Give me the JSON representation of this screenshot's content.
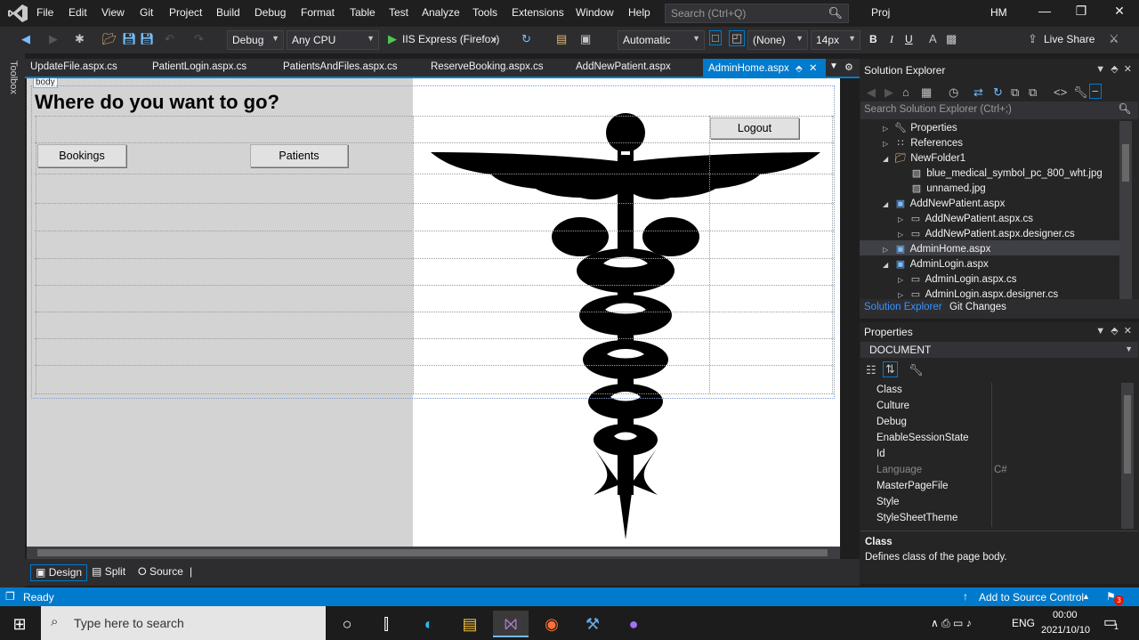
{
  "menubar": {
    "items": [
      "File",
      "Edit",
      "View",
      "Git",
      "Project",
      "Build",
      "Debug",
      "Format",
      "Table",
      "Test",
      "Analyze",
      "Tools",
      "Extensions",
      "Window",
      "Help"
    ],
    "search_placeholder": "Search (Ctrl+Q)",
    "project_name": "Proj",
    "user_initials": "HM"
  },
  "toolbar": {
    "config": "Debug",
    "platform": "Any CPU",
    "run_target": "IIS Express (Firefox)",
    "block_format": "Automatic",
    "style_target": "(None)",
    "font_size": "14px",
    "bold": "B",
    "italic": "I",
    "underline": "U",
    "live_share": "Live Share"
  },
  "toolbox_label": "Toolbox",
  "tabs": [
    {
      "label": "UpdateFile.aspx.cs"
    },
    {
      "label": "PatientLogin.aspx.cs"
    },
    {
      "label": "PatientsAndFiles.aspx.cs"
    },
    {
      "label": "ReserveBooking.aspx.cs"
    },
    {
      "label": "AddNewPatient.aspx"
    },
    {
      "label": "AdminHome.aspx"
    }
  ],
  "designer": {
    "body_tag": "body",
    "heading": "Where do you want to go?",
    "bookings_button": "Bookings",
    "patients_button": "Patients",
    "logout_button": "Logout"
  },
  "view_bar": {
    "design": "Design",
    "split": "Split",
    "source": "Source"
  },
  "solution_explorer": {
    "title": "Solution Explorer",
    "search_placeholder": "Search Solution Explorer (Ctrl+;)",
    "items": [
      {
        "label": "Properties"
      },
      {
        "label": "References"
      },
      {
        "label": "NewFolder1"
      },
      {
        "label": "blue_medical_symbol_pc_800_wht.jpg"
      },
      {
        "label": "unnamed.jpg"
      },
      {
        "label": "AddNewPatient.aspx"
      },
      {
        "label": "AddNewPatient.aspx.cs"
      },
      {
        "label": "AddNewPatient.aspx.designer.cs"
      },
      {
        "label": "AdminHome.aspx"
      },
      {
        "label": "AdminLogin.aspx"
      },
      {
        "label": "AdminLogin.aspx.cs"
      },
      {
        "label": "AdminLogin.aspx.designer.cs"
      }
    ],
    "tab_solution": "Solution Explorer",
    "tab_git": "Git Changes"
  },
  "properties": {
    "title": "Properties",
    "object": "DOCUMENT",
    "rows": [
      {
        "name": "Class",
        "value": ""
      },
      {
        "name": "Culture",
        "value": ""
      },
      {
        "name": "Debug",
        "value": ""
      },
      {
        "name": "EnableSessionState",
        "value": ""
      },
      {
        "name": "Id",
        "value": ""
      },
      {
        "name": "Language",
        "value": "C#"
      },
      {
        "name": "MasterPageFile",
        "value": ""
      },
      {
        "name": "Style",
        "value": ""
      },
      {
        "name": "StyleSheetTheme",
        "value": ""
      }
    ],
    "desc_title": "Class",
    "desc_text": "Defines class of the page body."
  },
  "statusbar": {
    "status": "Ready",
    "source_control": "Add to Source Control",
    "notifications": "3"
  },
  "taskbar": {
    "search_placeholder": "Type here to search",
    "language": "ENG",
    "time": "00:00",
    "date": "2021/10/10",
    "notification_count": "1"
  },
  "colors": {
    "accent": "#007acc",
    "designer_gray": "#d3d3d3"
  }
}
